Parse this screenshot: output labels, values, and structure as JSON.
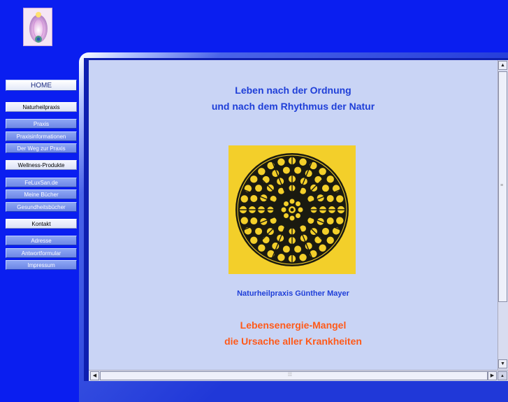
{
  "nav": {
    "home": "HOME",
    "sections": [
      {
        "title": "Naturheilpraxis",
        "items": [
          "Praxis",
          "Praxisinformationen",
          "Der Weg zur Praxis"
        ]
      },
      {
        "title": "Wellness-Produkte",
        "items": [
          "FeLuxSan.de",
          "Meine Bücher",
          "Gesundheitsbücher"
        ]
      },
      {
        "title": "Kontakt",
        "items": [
          "Adresse",
          "Antwortformular",
          "Impressum"
        ]
      }
    ]
  },
  "content": {
    "headline_line1": "Leben nach der Ordnung",
    "headline_line2": "und nach dem Rhythmus der Natur",
    "practice_name": "Naturheilpraxis Günther Mayer",
    "subheadline_line1": "Lebensenergie-Mangel",
    "subheadline_line2": "die Ursache aller Krankheiten"
  },
  "colors": {
    "background": "#0a1ef0",
    "content_bg": "#c9d4f5",
    "headline": "#1f3fd8",
    "subheadline": "#ff5a1a",
    "mandala_bg": "#f3cf2a"
  },
  "icons": {
    "logo": "aura-figure-logo",
    "mandala": "rose-window-mandala",
    "scroll_up": "triangle-up-icon",
    "scroll_down": "triangle-down-icon",
    "scroll_left": "triangle-left-icon",
    "scroll_right": "triangle-right-icon"
  }
}
